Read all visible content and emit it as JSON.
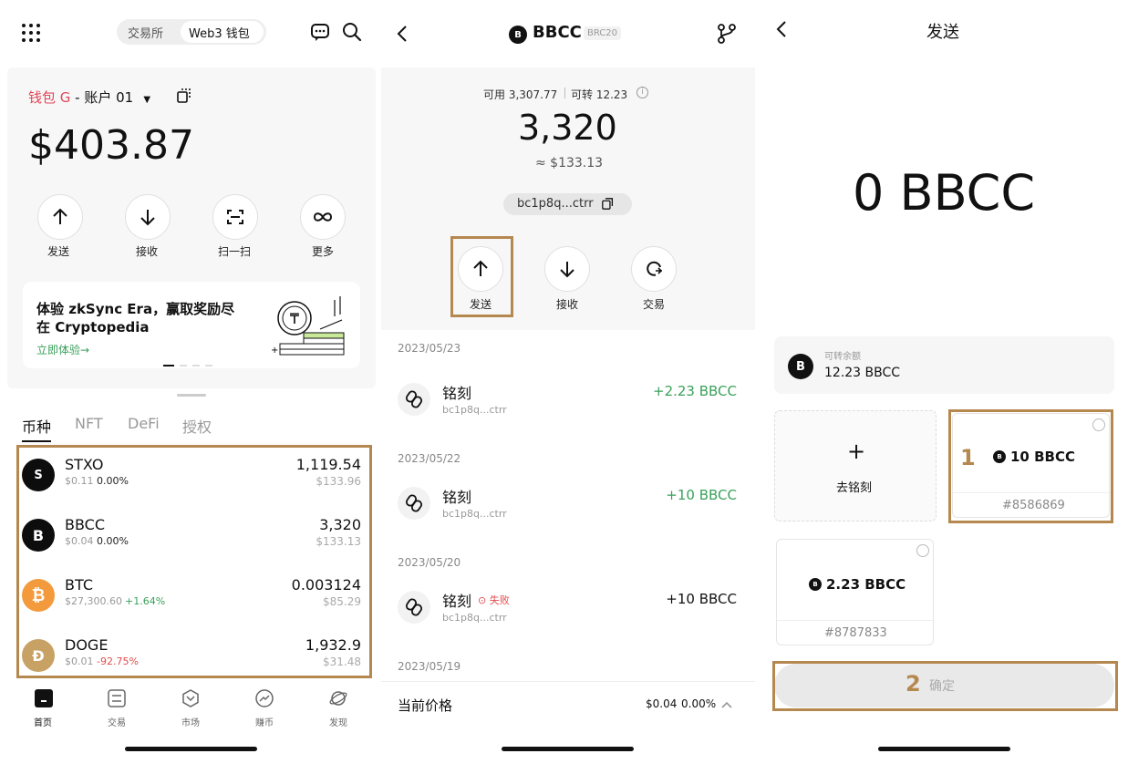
{
  "wallet": {
    "tabs": [
      "交易所",
      "Web3 钱包"
    ],
    "wallet_name": "钱包 G",
    "account": " - 账户 01",
    "balance": "$403.87",
    "actions": [
      "发送",
      "接收",
      "扫一扫",
      "更多"
    ],
    "banner": {
      "title_line1": "体验 zkSync Era，赢取奖励尽",
      "title_line2": "在 Cryptopedia",
      "link": "立即体验→"
    },
    "asset_tabs": [
      "币种",
      "NFT",
      "DeFi",
      "授权"
    ],
    "tokens": [
      {
        "icon": "S",
        "name": "STXO",
        "price": "$0.11",
        "change": "0.00%",
        "amount": "1,119.54",
        "value": "$133.96",
        "color": "#0d0d0d",
        "change_color": "#222"
      },
      {
        "icon": "B",
        "name": "BBCC",
        "price": "$0.04",
        "change": "0.00%",
        "amount": "3,320",
        "value": "$133.13",
        "color": "#0d0d0d",
        "change_color": "#222"
      },
      {
        "icon": "₿",
        "name": "BTC",
        "price": "$27,300.60",
        "change": "+1.64%",
        "amount": "0.003124",
        "value": "$85.29",
        "color": "#f39a3c",
        "change_color": "#3aa05a"
      },
      {
        "icon": "Ð",
        "name": "DOGE",
        "price": "$0.01",
        "change": "-92.75%",
        "amount": "1,932.9",
        "value": "$31.48",
        "color": "#c8a165",
        "change_color": "#e24c4c"
      }
    ],
    "nav": [
      "首页",
      "交易",
      "市场",
      "赚币",
      "发现"
    ]
  },
  "detail": {
    "token_name": "BBCC",
    "token_tag": "BRC20",
    "available": "可用 3,307.77",
    "transferable": "可转 12.23",
    "amount": "3,320",
    "usd": "≈ $133.13",
    "address": "bc1p8q...ctrr",
    "actions": [
      "发送",
      "接收",
      "交易"
    ],
    "groups": [
      {
        "date": "2023/05/23",
        "title": "铭刻",
        "addr": "bc1p8q...ctrr",
        "amount": "+2.23 BBCC",
        "failed": false
      },
      {
        "date": "2023/05/22",
        "title": "铭刻",
        "addr": "bc1p8q...ctrr",
        "amount": "+10 BBCC",
        "failed": false
      },
      {
        "date": "2023/05/20",
        "title": "铭刻",
        "addr": "bc1p8q...ctrr",
        "amount": "+10 BBCC",
        "failed": true,
        "failed_label": "失败"
      }
    ],
    "last_date": "2023/05/19",
    "price_label": "当前价格",
    "price_value": "$0.04",
    "price_change": "0.00%"
  },
  "send": {
    "title": "发送",
    "amount": "0 BBCC",
    "transferable_label": "可转余额",
    "transferable_value": "12.23 BBCC",
    "inscribe_label": "去铭刻",
    "cards": [
      {
        "marker": "1",
        "amount": "10 BBCC",
        "id": "#8586869"
      },
      {
        "amount": "2.23 BBCC",
        "id": "#8787833"
      }
    ],
    "confirm_marker": "2",
    "confirm_label": "确定"
  },
  "colors": {
    "highlight": "#b5884f",
    "accent_red": "#e0475a",
    "positive": "#3aa05a",
    "negative": "#e24c4c"
  }
}
